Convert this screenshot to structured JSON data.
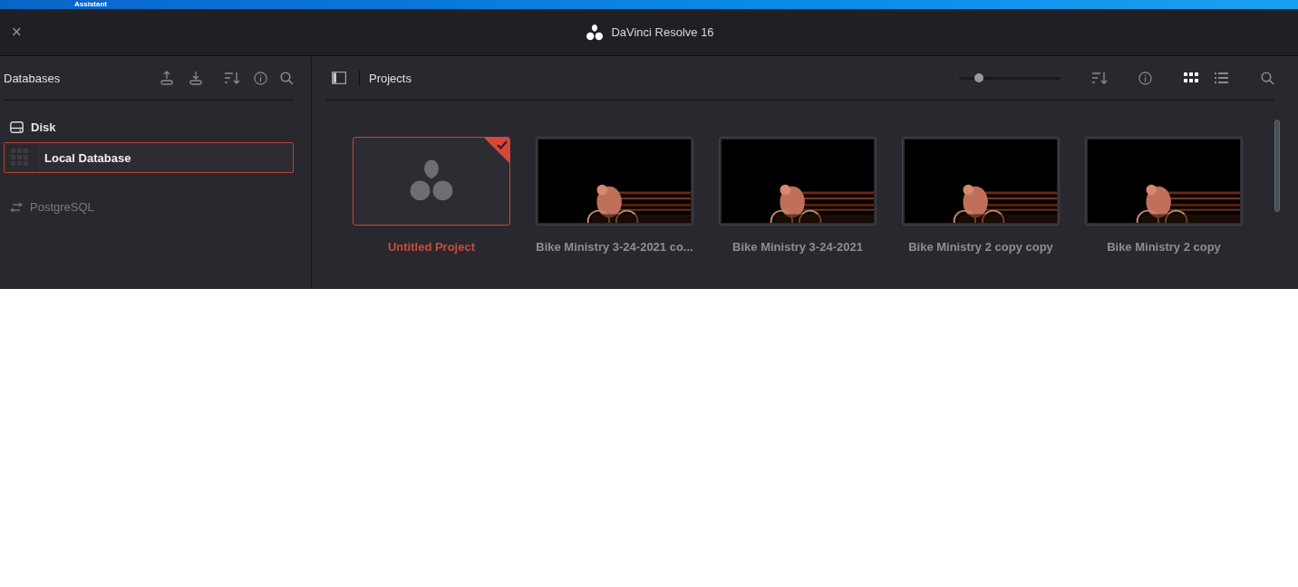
{
  "taskbar": {
    "label": "Assistant"
  },
  "window": {
    "title": "DaVinci Resolve 16",
    "close": "×"
  },
  "databases": {
    "title": "Databases",
    "sections": [
      {
        "kind": "disk",
        "label": "Disk",
        "items": [
          {
            "label": "Local Database",
            "selected": true
          }
        ]
      },
      {
        "kind": "postgres",
        "label": "PostgreSQL"
      }
    ]
  },
  "projects": {
    "title": "Projects",
    "zoom": {
      "level": 0.2
    },
    "views": [
      {
        "kind": "grid",
        "selected": true
      },
      {
        "kind": "list",
        "selected": false
      }
    ],
    "items": [
      {
        "kind": "blank",
        "name": "Untitled Project",
        "selected": true
      },
      {
        "kind": "picture",
        "name": "Bike Ministry 3-24-2021 co...",
        "selected": false
      },
      {
        "kind": "picture",
        "name": "Bike Ministry 3-24-2021",
        "selected": false
      },
      {
        "kind": "picture",
        "name": "Bike Ministry 2 copy copy",
        "selected": false
      },
      {
        "kind": "picture",
        "name": "Bike Ministry 2 copy",
        "selected": false
      }
    ]
  }
}
